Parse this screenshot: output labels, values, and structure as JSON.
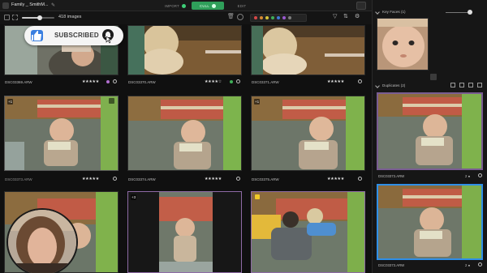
{
  "app": {
    "project_title": "Family _ SmithM...",
    "steps": [
      {
        "label": "IMPORT",
        "state": "done"
      },
      {
        "label": "CULL",
        "state": "active"
      },
      {
        "label": "EDIT",
        "state": "todo"
      }
    ],
    "accent_color": "#2f9f5a",
    "selection_color": "#8d6aa5",
    "active_color": "#2f8fe7"
  },
  "toolbar": {
    "image_count": "418 images",
    "size_slider_fraction": 0.55,
    "color_labels": [
      "#d94848",
      "#d98a32",
      "#d6c43a",
      "#3fae58",
      "#3f78d6",
      "#9b59d1",
      "#7d7d7d"
    ],
    "icons": [
      "grid-icon",
      "list-icon",
      "zoom-slider",
      "trash-icon",
      "compare-icon",
      "color-label-filter",
      "filter-icon",
      "sort-icon",
      "settings-icon"
    ]
  },
  "overlay": {
    "subscribe_label": "SUBSCRIBED",
    "icons": [
      "thumbs-up-icon",
      "bell-icon",
      "cursor-icon"
    ]
  },
  "grid": {
    "rows": [
      [
        {
          "name": "DSC03369.ARW",
          "stars": "★★★★★",
          "status": "circle",
          "color_dot": "#b26fd0"
        },
        {
          "name": "DSC03370.ARW",
          "stars": "★★★★☆",
          "status": "circle",
          "color_dot": "#3fae58"
        },
        {
          "name": "DSC03371.ARW",
          "stars": "★★★★★",
          "status": "circle",
          "color_dot": ""
        }
      ],
      [
        {
          "name": "DSC03373.ARW",
          "stars": "★★★★★",
          "status": "circle",
          "color_dot": "",
          "badge": "+1",
          "selected": true
        },
        {
          "name": "DSC03374.ARW",
          "stars": "★★★★★",
          "status": "circle",
          "color_dot": ""
        },
        {
          "name": "DSC03375.ARW",
          "stars": "★★★★★",
          "status": "circle",
          "color_dot": "",
          "badge": "+1"
        }
      ],
      [
        {
          "name": "",
          "stars": "",
          "status": "",
          "color_dot": ""
        },
        {
          "name": "",
          "stars": "",
          "status": "",
          "color_dot": "",
          "badge": "+3",
          "selected": true
        },
        {
          "name": "",
          "stars": "",
          "status": "",
          "color_dot": "",
          "selected": true
        }
      ]
    ]
  },
  "right_panel": {
    "key_faces_title": "Key Faces (1)",
    "duplicates_title": "Duplicates (2)",
    "duplicates": [
      {
        "name": "DSC03373.ARW",
        "count": "2 ●"
      },
      {
        "name": "DSC03373.ARW",
        "count": "2 ●"
      }
    ]
  }
}
